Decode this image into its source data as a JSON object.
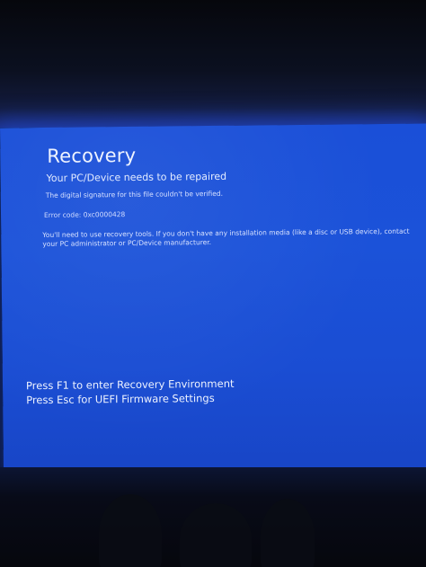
{
  "recovery_screen": {
    "title": "Recovery",
    "subtitle": "Your PC/Device needs to be repaired",
    "signature_message": "The digital signature for this file couldn't be verified.",
    "error_code": "Error code: 0xc0000428",
    "instructions": "You'll need to use recovery tools. If you don't have any installation media (like a disc or USB device), contact your PC administrator or PC/Device manufacturer.",
    "key_hints": [
      "Press F1 to enter Recovery Environment",
      "Press Esc for UEFI Firmware Settings"
    ]
  },
  "colors": {
    "screen_background": "#1a4fd8",
    "text": "#e9efff",
    "surroundings": "#07080d"
  }
}
